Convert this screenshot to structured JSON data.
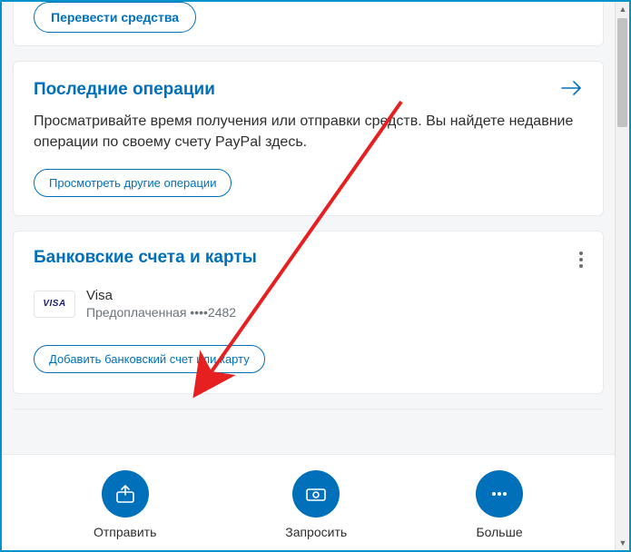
{
  "top_partial": {
    "transfer_label": "Перевести средства"
  },
  "recent": {
    "title": "Последние операции",
    "description": "Просматривайте время получения или отправки средств. Вы найдете недавние операции по своему счету PayPal здесь.",
    "view_more_label": "Просмотреть другие операции"
  },
  "wallet": {
    "title": "Банковские счета и карты",
    "card_brand": "Visa",
    "card_subtype": "Предоплаченная ••••2482",
    "visa_logo_text": "VISA",
    "add_label": "Добавить банковский счет или карту"
  },
  "bottom_bar": {
    "send": "Отправить",
    "request": "Запросить",
    "more": "Больше"
  }
}
